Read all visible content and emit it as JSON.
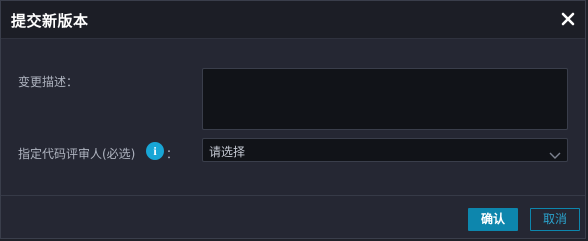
{
  "dialog": {
    "title": "提交新版本",
    "close_icon": "close-icon"
  },
  "form": {
    "description_label": "变更描述：",
    "description_value": "",
    "reviewer_label": "指定代码评审人(必选)",
    "reviewer_colon": "：",
    "info_icon": "info-icon",
    "info_glyph": "i",
    "reviewer_select_value": "请选择",
    "chevron_icon": "chevron-down-icon"
  },
  "footer": {
    "confirm_label": "确认",
    "cancel_label": "取消"
  },
  "colors": {
    "background": "#252733",
    "header": "#1c1e26",
    "accent": "#0d86ad",
    "info": "#18a6d6"
  }
}
